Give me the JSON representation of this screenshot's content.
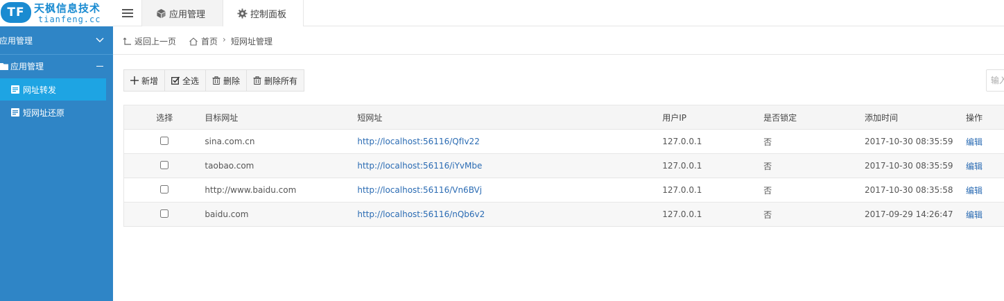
{
  "brand": {
    "badge": "TF",
    "title": "天枫信息技术",
    "subtitle": "tianfeng.cc"
  },
  "top_tabs": [
    {
      "label": "应用管理",
      "icon": "cube-icon"
    },
    {
      "label": "控制面板",
      "icon": "gear-icon"
    }
  ],
  "sidebar": {
    "section_label": "应用管理",
    "group_label": "应用管理",
    "items": [
      {
        "label": "网址转发",
        "active": true
      },
      {
        "label": "短网址还原",
        "active": false
      }
    ]
  },
  "breadcrumb": {
    "back_label": "返回上一页",
    "home_label": "首页",
    "separator": "›",
    "current": "短网址管理"
  },
  "toolbar": {
    "add_label": "新增",
    "select_all_label": "全选",
    "delete_label": "删除",
    "delete_all_label": "删除所有"
  },
  "search": {
    "placeholder": "输入"
  },
  "table": {
    "headers": {
      "select": "选择",
      "target": "目标网址",
      "short": "短网址",
      "ip": "用户IP",
      "locked": "是否锁定",
      "added": "添加时间",
      "action": "操作"
    },
    "rows": [
      {
        "target": "sina.com.cn",
        "short": "http://localhost:56116/QfIv22",
        "ip": "127.0.0.1",
        "locked": "否",
        "added": "2017-10-30 08:35:59",
        "action": "编辑"
      },
      {
        "target": "taobao.com",
        "short": "http://localhost:56116/iYvMbe",
        "ip": "127.0.0.1",
        "locked": "否",
        "added": "2017-10-30 08:35:59",
        "action": "编辑"
      },
      {
        "target": "http://www.baidu.com",
        "short": "http://localhost:56116/Vn6BVj",
        "ip": "127.0.0.1",
        "locked": "否",
        "added": "2017-10-30 08:35:58",
        "action": "编辑"
      },
      {
        "target": "baidu.com",
        "short": "http://localhost:56116/nQb6v2",
        "ip": "127.0.0.1",
        "locked": "否",
        "added": "2017-09-29 14:26:47",
        "action": "编辑"
      }
    ]
  },
  "colors": {
    "sidebar_bg": "#2f85c6",
    "sidebar_active": "#1ea4e3",
    "brand": "#1a8bd1",
    "link": "#2a6bb3"
  }
}
